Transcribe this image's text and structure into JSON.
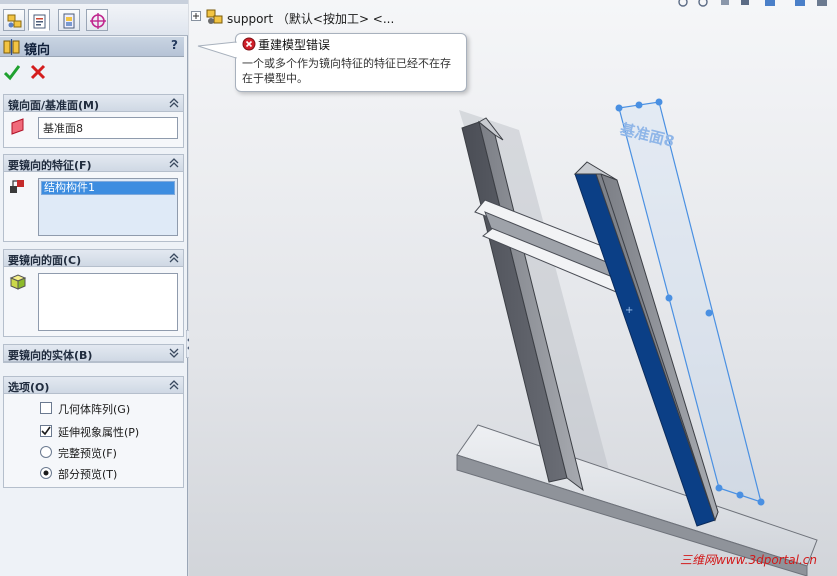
{
  "panel": {
    "header": {
      "title": "镜向",
      "help": "?"
    },
    "groups": {
      "mirror_plane": {
        "title": "镜向面/基准面(M)",
        "value": "基准面8"
      },
      "features": {
        "title": "要镜向的特征(F)",
        "items": [
          "结构构件1"
        ]
      },
      "faces": {
        "title": "要镜向的面(C)"
      },
      "bodies": {
        "title": "要镜向的实体(B)"
      },
      "options": {
        "title": "选项(O)",
        "geometry_pattern": {
          "label": "几何体阵列(G)",
          "checked": false
        },
        "propagate_visual": {
          "label": "延伸视象属性(P)",
          "checked": true
        },
        "full_preview": {
          "label": "完整预览(F)",
          "selected": false
        },
        "partial_preview": {
          "label": "部分预览(T)",
          "selected": true
        }
      }
    }
  },
  "viewport": {
    "tree_root": "support （默认<按加工> <...",
    "callout": {
      "title": "重建模型错误",
      "message": "一个或多个作为镜向特征的特征已经不在存在于模型中。"
    },
    "plane_label": "基准面8",
    "watermark": "三维网www.3dportal.cn"
  },
  "colors": {
    "selected_face": "#0b3f86",
    "plane_outline": "#4a90e2",
    "ok": "#1fa12f",
    "cancel": "#d41e1e"
  }
}
